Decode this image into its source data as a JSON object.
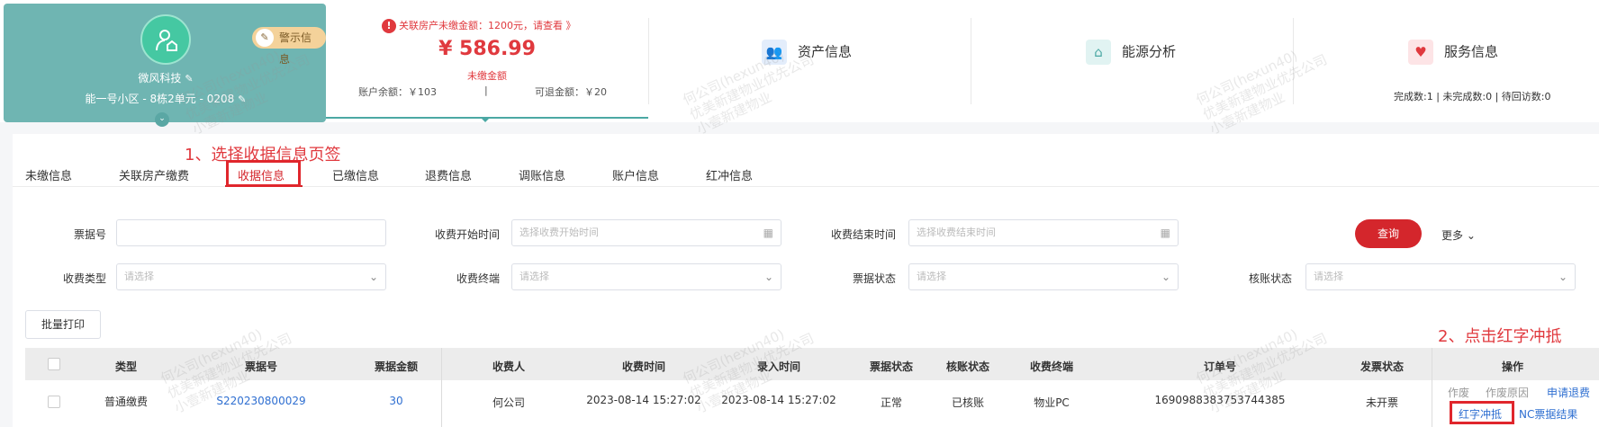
{
  "profile": {
    "warning_tag": "警示信息",
    "company": "微风科技",
    "address": "能一号小区 - 8栋2单元 - 0208"
  },
  "amount_panel": {
    "alert": "关联房产未缴金额：1200元，请查看 》",
    "amount": "¥ 586.99",
    "amount_label": "未缴金额",
    "balance": "账户余额：￥103",
    "separator": "|",
    "refundable": "可退金额：￥20"
  },
  "info_boxes": {
    "asset": "资产信息",
    "energy": "能源分析",
    "service": "服务信息",
    "service_stats": "完成数:1 | 未完成数:0 | 待回访数:0"
  },
  "watermark": {
    "line1": "何公司(hexun40)",
    "line2": "优美新建物业优先公司",
    "line3": "小壹新建物业"
  },
  "tabs": [
    "未缴信息",
    "关联房产缴费",
    "收据信息",
    "已缴信息",
    "退费信息",
    "调账信息",
    "账户信息",
    "红冲信息"
  ],
  "annotations": {
    "step1": "1、选择收据信息页签",
    "step2": "2、点击红字冲抵"
  },
  "filters": {
    "receipt_no": {
      "label": "票据号",
      "placeholder": ""
    },
    "start_time": {
      "label": "收费开始时间",
      "placeholder": "选择收费开始时间"
    },
    "end_time": {
      "label": "收费结束时间",
      "placeholder": "选择收费结束时间"
    },
    "fee_type": {
      "label": "收费类型",
      "placeholder": "请选择"
    },
    "terminal": {
      "label": "收费终端",
      "placeholder": "请选择"
    },
    "receipt_status": {
      "label": "票据状态",
      "placeholder": "请选择"
    },
    "verify_status": {
      "label": "核账状态",
      "placeholder": "请选择"
    },
    "query": "查询",
    "more": "更多"
  },
  "batch_print": "批量打印",
  "table": {
    "headers": [
      "类型",
      "票据号",
      "票据金额",
      "收费人",
      "收费时间",
      "录入时间",
      "票据状态",
      "核账状态",
      "收费终端",
      "订单号",
      "发票状态",
      "操作"
    ],
    "rows": [
      {
        "type": "普通缴费",
        "receipt_no": "S220230800029",
        "amount": "30",
        "payee": "何公司",
        "charge_time": "2023-08-14 15:27:02",
        "entry_time": "2023-08-14 15:27:02",
        "receipt_status": "正常",
        "verify_status": "已核账",
        "terminal": "物业PC",
        "order_no": "1690988383753744385",
        "invoice_status": "未开票",
        "ops": {
          "void": "作废",
          "void_reason": "作废原因",
          "apply_refund": "申请退费",
          "red_offset": "红字冲抵",
          "nc_result": "NC票据结果"
        }
      }
    ]
  },
  "colors": {
    "accent_red": "#d4262c",
    "teal": "#6fb5b2",
    "link_blue": "#2f6fd1"
  }
}
